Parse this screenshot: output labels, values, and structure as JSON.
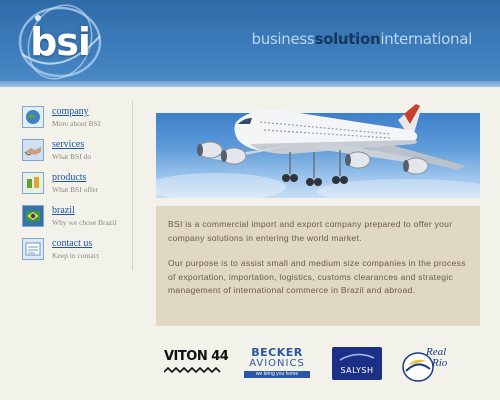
{
  "header": {
    "logo_text": "bsi",
    "tagline_part1": "business",
    "tagline_part2": "solution",
    "tagline_part3": "international"
  },
  "nav": [
    {
      "title": "company",
      "subtitle": "More about BSI",
      "icon": "globe-icon"
    },
    {
      "title": "services",
      "subtitle": "What BSI do",
      "icon": "handshake-icon"
    },
    {
      "title": "products",
      "subtitle": "What BSI offer",
      "icon": "products-icon"
    },
    {
      "title": "brazil",
      "subtitle": "Why we chose Brazil",
      "icon": "brazil-flag-icon"
    },
    {
      "title": "contact us",
      "subtitle": "Keep in contact",
      "icon": "contact-icon"
    }
  ],
  "about": {
    "paragraph1": "BSI is a commercial import and export company prepared to offer your company solutions in entering the world market.",
    "paragraph2": "Our purpose is to assist small and medium size companies in the process of exportation, importation, logistics, customs clearances and strategic management of international commerce in Brazil and abroad."
  },
  "partners": {
    "viton": "VITON 44",
    "becker_line1": "BECKER",
    "becker_line2": "AVIONICS",
    "becker_tag": "we bring you home",
    "salysh": "SALYSH",
    "realrio_line1": "Real",
    "realrio_line2": "Rio"
  },
  "colors": {
    "header_blue": "#3a79b8",
    "nav_link": "#1e56a0",
    "about_bg": "#e1d8c3",
    "about_text": "#6b5b45",
    "page_bg": "#f2f1ea"
  }
}
